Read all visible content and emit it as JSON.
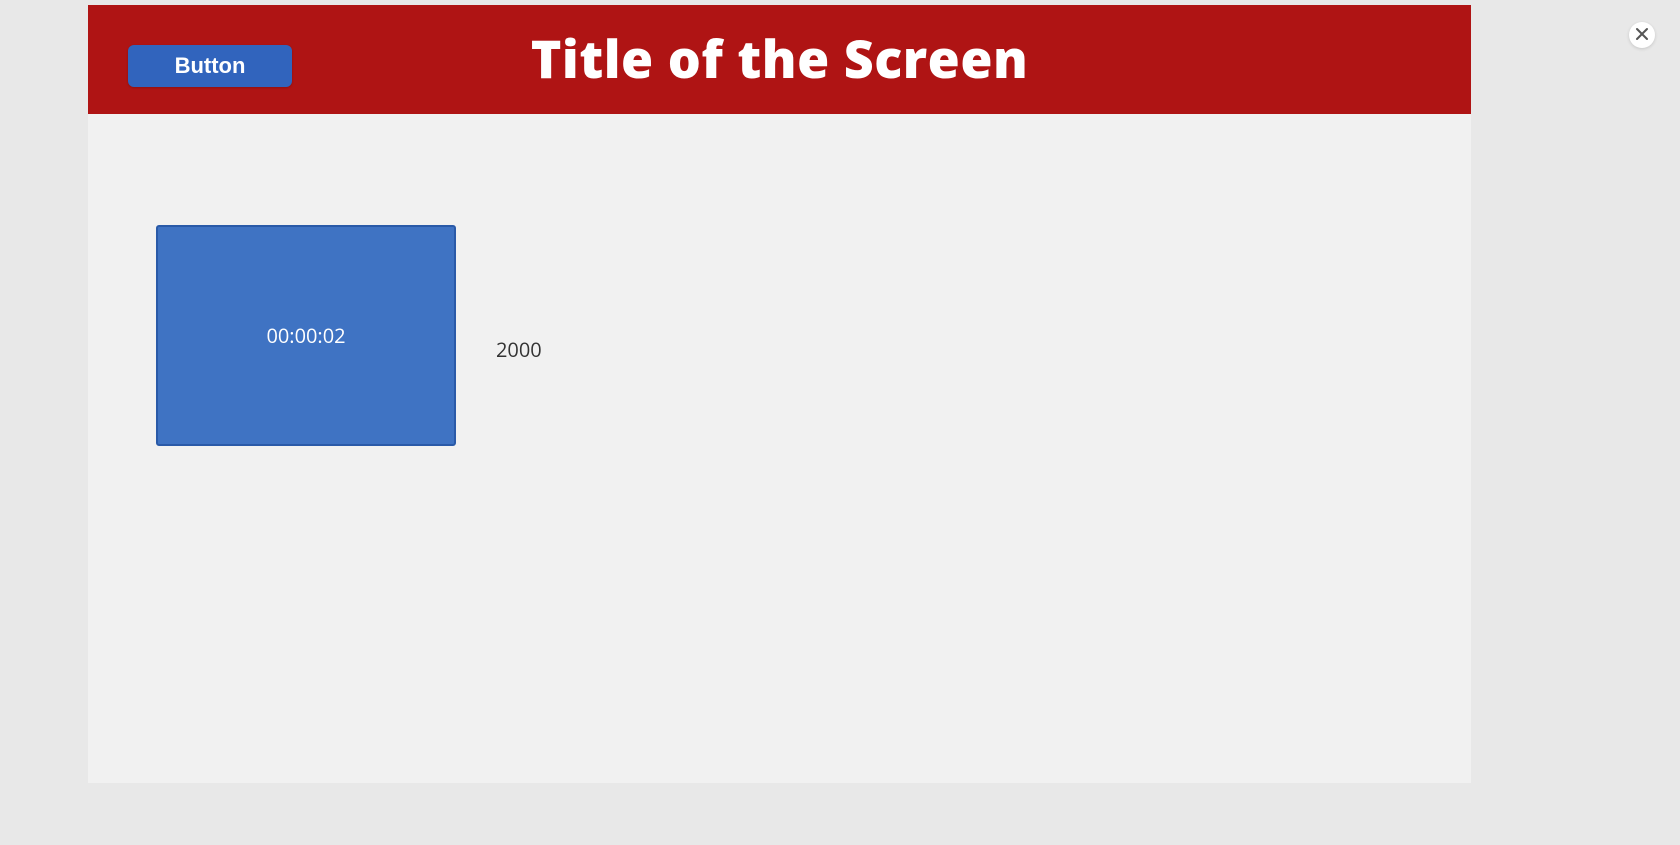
{
  "header": {
    "button_label": "Button",
    "title": "Title of the Screen"
  },
  "content": {
    "timer_value": "00:00:02",
    "number_value": "2000"
  },
  "colors": {
    "header_bg": "#af1414",
    "button_bg": "#3164bd",
    "card_bg": "#3f73c3"
  }
}
